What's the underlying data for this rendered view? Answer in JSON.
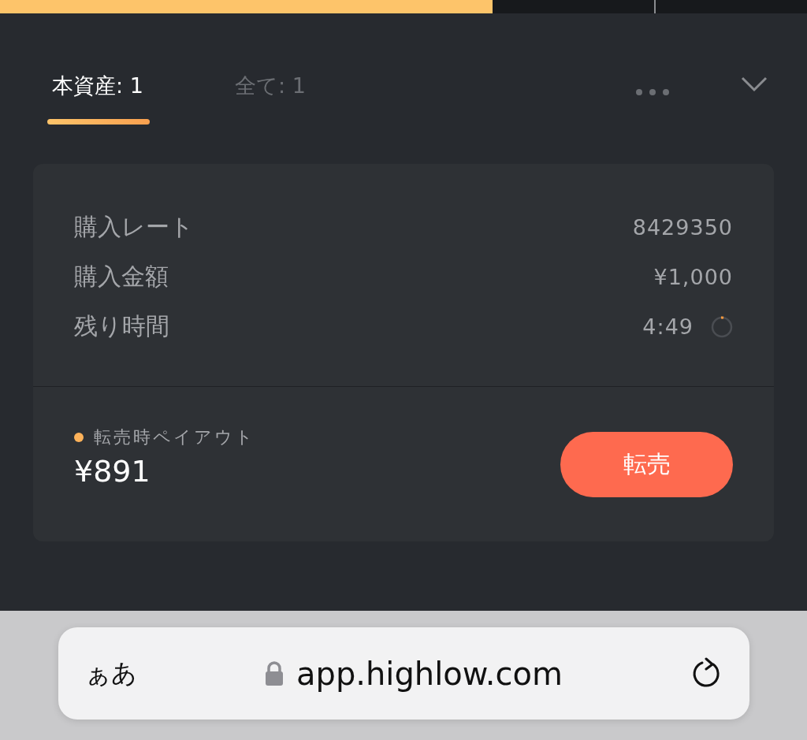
{
  "top_progress": {
    "level": 0.61
  },
  "tabs": [
    {
      "label": "本資産: 1",
      "selected": true
    },
    {
      "label": "全て: 1",
      "selected": false
    }
  ],
  "trade_card": {
    "rows": [
      {
        "label": "購入レート",
        "value": "8429350",
        "kind": "plain"
      },
      {
        "label": "購入金額",
        "value": "¥1,000",
        "kind": "plain"
      },
      {
        "label": "残り時間",
        "value": "4:49",
        "kind": "timer"
      }
    ],
    "payout_label": "転売時ペイアウト",
    "payout_value": "¥891",
    "resell_button": "転売"
  },
  "browser_bar": {
    "text_size": "ぁあ",
    "url": "app.highlow.com"
  }
}
